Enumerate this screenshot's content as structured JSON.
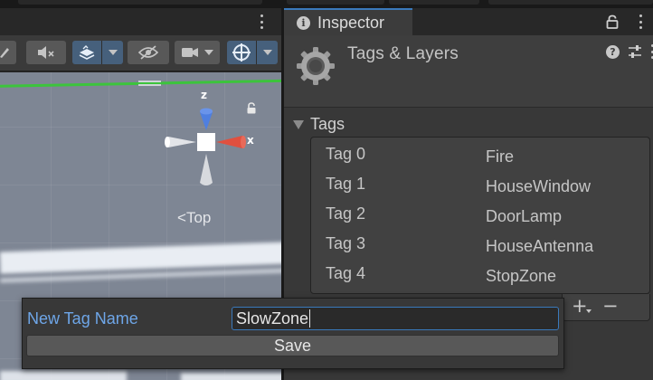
{
  "inspector": {
    "tab_label": "Inspector",
    "title": "Tags & Layers",
    "foldout_label": "Tags",
    "tags": [
      {
        "key": "Tag 0",
        "value": "Fire"
      },
      {
        "key": "Tag 1",
        "value": "HouseWindow"
      },
      {
        "key": "Tag 2",
        "value": "DoorLamp"
      },
      {
        "key": "Tag 3",
        "value": "HouseAntenna"
      },
      {
        "key": "Tag 4",
        "value": "StopZone"
      }
    ],
    "add_button_label": "+",
    "remove_button_label": "−"
  },
  "scene": {
    "gizmo": {
      "y_label": "z",
      "x_label": "x",
      "view_label": "Top"
    }
  },
  "popup": {
    "label": "New Tag Name",
    "input_value": "SlowZone",
    "save_label": "Save"
  },
  "colors": {
    "accent": "#3a79bb",
    "label_blue": "#6ea6e8",
    "gizmo_z": "#4f7fe0",
    "gizmo_x": "#e0503f",
    "grid_green": "#3cc43c"
  }
}
